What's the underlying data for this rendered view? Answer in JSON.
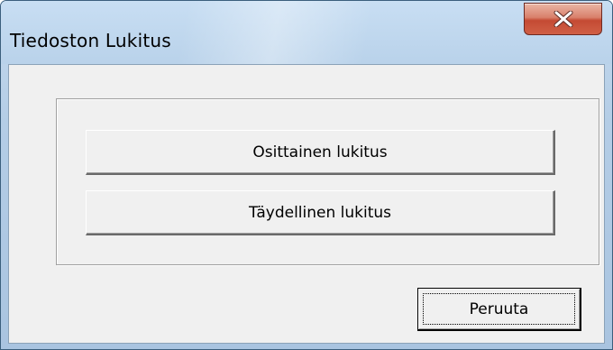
{
  "window": {
    "title": "Tiedoston Lukitus"
  },
  "titlebar": {
    "close_icon": "close-icon"
  },
  "buttons": {
    "partial_lock": "Osittainen lukitus",
    "full_lock": "Täydellinen lukitus",
    "cancel": "Peruuta"
  },
  "colors": {
    "frame": "#b9d2ea",
    "client_bg": "#f0f0f0",
    "close_red": "#c44a33"
  }
}
